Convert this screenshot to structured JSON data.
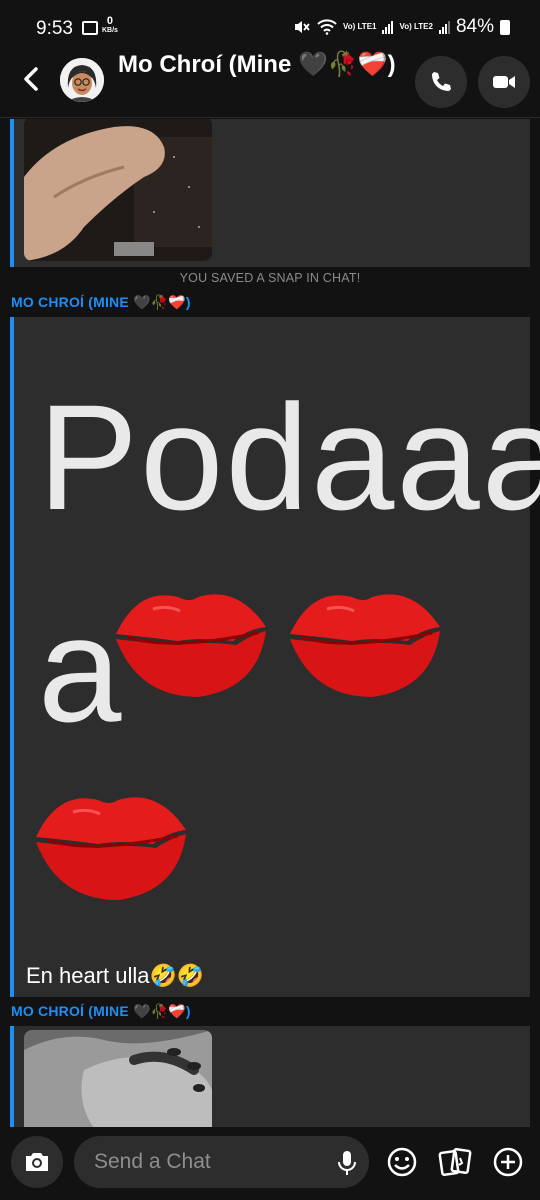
{
  "status": {
    "time": "9:53",
    "speed_value": "0",
    "speed_unit": "KB/s",
    "net1": "Vo) LTE1",
    "net2": "Vo) LTE2",
    "battery": "84%"
  },
  "header": {
    "contact_name": "Mo Chroí (Mine 🖤🥀❤️‍🩹)"
  },
  "chat": {
    "saved_note": "YOU SAVED A SNAP IN CHAT!",
    "sender_1": "MO CHROÍ (MINE 🖤🥀❤️‍🩹)",
    "message_line1": "Podaaa",
    "message_line2": "a",
    "caption": "En heart ulla🤣🤣",
    "sender_2": "MO CHROÍ (MINE 🖤🥀❤️‍🩹)"
  },
  "composer": {
    "placeholder": "Send a Chat"
  },
  "colors": {
    "accent": "#1f8ff5",
    "bubble": "#2d2d2d",
    "background": "#121212",
    "kiss_red": "#e51c1c"
  },
  "icons": [
    "back-arrow-icon",
    "avatar",
    "phone-icon",
    "video-icon",
    "camera-icon",
    "microphone-icon",
    "emoji-icon",
    "cards-icon",
    "plus-icon"
  ]
}
